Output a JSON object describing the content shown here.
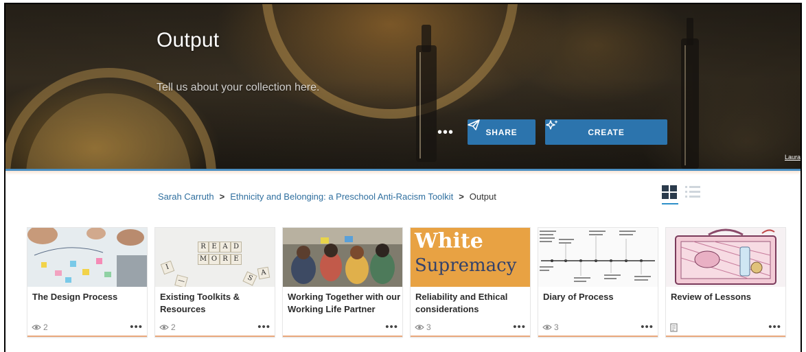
{
  "hero": {
    "title": "Output",
    "description": "Tell us about your collection here.",
    "share_label": "SHARE",
    "create_label": "CREATE",
    "more_label": "•••",
    "photo_credit": "Laura"
  },
  "breadcrumb": {
    "items": [
      "Sarah Carruth",
      "Ethnicity and Belonging: a Preschool Anti-Racism Toolkit"
    ],
    "separator": ">",
    "current": "Output"
  },
  "view_toggle": {
    "active": "grid"
  },
  "cards": [
    {
      "title": "The Design Process",
      "views": "2",
      "footer_icon": "eye-icon",
      "more": "•••"
    },
    {
      "title": "Existing Toolkits & Resources",
      "views": "2",
      "footer_icon": "eye-icon",
      "more": "•••"
    },
    {
      "title": "Working Together with our Working Life Partner",
      "views": "",
      "footer_icon": "",
      "more": "•••"
    },
    {
      "title": "Reliability and Ethical considerations",
      "views": "3",
      "footer_icon": "eye-icon",
      "more": "•••"
    },
    {
      "title": "Diary of Process",
      "views": "3",
      "footer_icon": "eye-icon",
      "more": "•••"
    },
    {
      "title": "Review of Lessons",
      "views": "",
      "footer_icon": "note-icon",
      "more": "•••"
    }
  ],
  "thumb_text": {
    "read": "READ",
    "more": "MORE",
    "white": "White",
    "supremacy": "Supremacy"
  },
  "colors": {
    "accent": "#2c74ad",
    "link": "#2f6f9f",
    "card_underline": "#e9a77b",
    "hero_rule": "#4b8fc2"
  }
}
